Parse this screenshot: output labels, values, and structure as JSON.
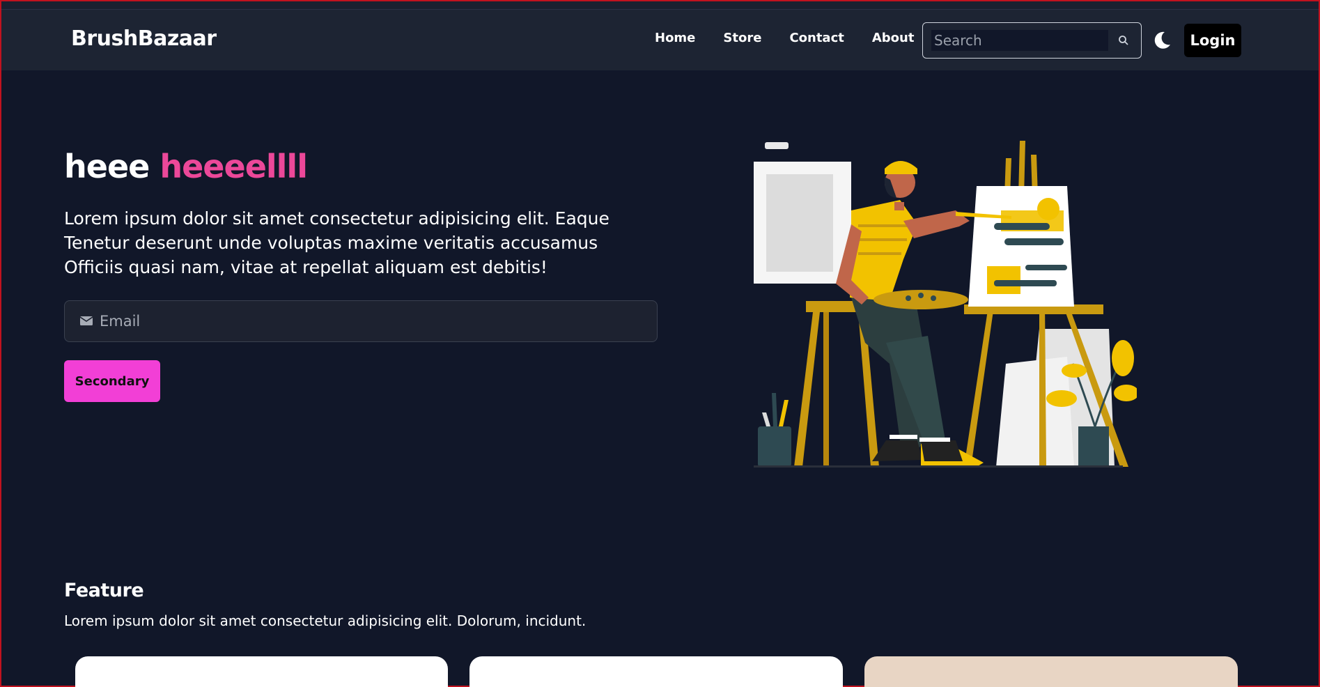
{
  "nav": {
    "brand": "BrushBazaar",
    "links": [
      "Home",
      "Store",
      "Contact",
      "About"
    ],
    "search_placeholder": "Search",
    "login_label": "Login"
  },
  "hero": {
    "title_plain": "heee",
    "title_accent": "heeeellll",
    "description": "Lorem ipsum dolor sit amet consectetur adipisicing elit. Eaque Tenetur deserunt unde voluptas maxime veritatis accusamus Officiis quasi nam, vitae at repellat aliquam est debitis!",
    "email_placeholder": "Email",
    "secondary_label": "Secondary"
  },
  "feature": {
    "title": "Feature",
    "description": "Lorem ipsum dolor sit amet consectetur adipisicing elit. Dolorum, incidunt."
  },
  "colors": {
    "background": "#111729",
    "navbar": "#1d2433",
    "accent_pink": "#ec4899",
    "button_pink": "#f23fd6"
  },
  "icons": [
    "search-icon",
    "moon-icon",
    "envelope-icon"
  ]
}
